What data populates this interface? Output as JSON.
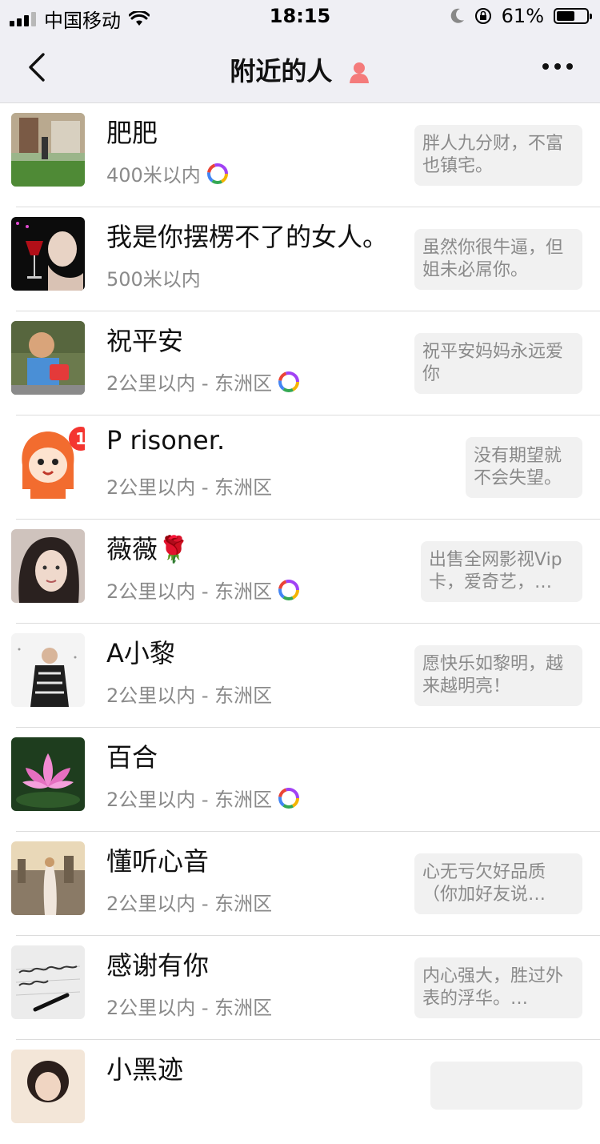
{
  "status_bar": {
    "carrier": "中国移动",
    "time": "18:15",
    "battery": "61%",
    "battery_level": 0.61
  },
  "nav": {
    "title": "附近的人",
    "back_icon": "chevron-left-icon",
    "more_icon": "more-dots-icon",
    "gender_icon": "female-person-icon",
    "gender_color": "#f47b7b"
  },
  "people": [
    {
      "name": "肥肥",
      "distance": "400米以内",
      "signature": "胖人九分财，不富也镇宅。",
      "moments_ring": true
    },
    {
      "name": "我是你摆楞不了的女人。",
      "distance": "500米以内",
      "signature": "虽然你很牛逼，但姐未必屌你。",
      "moments_ring": false
    },
    {
      "name": "祝平安",
      "distance": "2公里以内 - 东洲区",
      "signature": "祝平安妈妈永远爱你",
      "moments_ring": true
    },
    {
      "name": "P risoner.",
      "distance": "2公里以内 - 东洲区",
      "signature": "没有期望就不会失望。",
      "moments_ring": false,
      "badge": "1"
    },
    {
      "name": "薇薇🌹",
      "distance": "2公里以内 - 东洲区",
      "signature": "出售全网影视Vip卡，爱奇艺，…",
      "moments_ring": true
    },
    {
      "name": "A小黎",
      "distance": "2公里以内 - 东洲区",
      "signature": "愿快乐如黎明，越来越明亮！",
      "moments_ring": false
    },
    {
      "name": "百合",
      "distance": "2公里以内 - 东洲区",
      "signature": "",
      "moments_ring": true
    },
    {
      "name": "懂听心音",
      "distance": "2公里以内 - 东洲区",
      "signature": "心无亏欠好品质（你加好友说…",
      "moments_ring": false
    },
    {
      "name": "感谢有你",
      "distance": "2公里以内 - 东洲区",
      "signature": "内心强大，胜过外表的浮华。…",
      "moments_ring": false
    },
    {
      "name": "小黑迹",
      "distance": "",
      "signature": "",
      "moments_ring": false
    }
  ]
}
